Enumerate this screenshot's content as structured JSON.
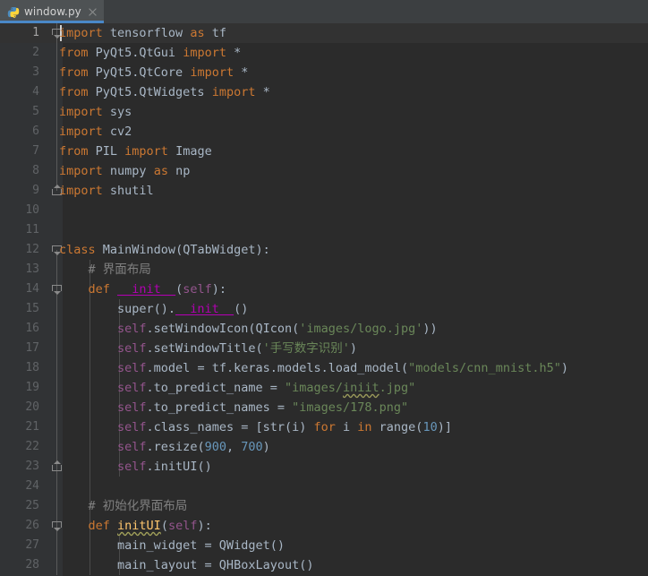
{
  "window": {
    "background": "#2b2b2b",
    "gutter_background": "#313335",
    "tabbar_background": "#3c3f41",
    "accent": "#4a88c7"
  },
  "tabs": [
    {
      "label": "window.py",
      "icon": "python-file-icon",
      "active": true,
      "close_icon": "close-icon"
    }
  ],
  "editor": {
    "language": "Python",
    "current_line": 1,
    "caret_line": 1,
    "caret_column": 1,
    "first_visible_line": 1,
    "last_visible_line": 28,
    "colors": {
      "keyword": "#cc7832",
      "string": "#6a8759",
      "number": "#6897bb",
      "comment": "#808080",
      "self": "#94558d",
      "function": "#ffc66d",
      "magic_method": "#b200b2",
      "default_text": "#a9b7c6",
      "line_number": "#606366"
    },
    "lines": [
      {
        "n": 1,
        "text": "import tensorflow as tf"
      },
      {
        "n": 2,
        "text": "from PyQt5.QtGui import *"
      },
      {
        "n": 3,
        "text": "from PyQt5.QtCore import *"
      },
      {
        "n": 4,
        "text": "from PyQt5.QtWidgets import *"
      },
      {
        "n": 5,
        "text": "import sys"
      },
      {
        "n": 6,
        "text": "import cv2"
      },
      {
        "n": 7,
        "text": "from PIL import Image"
      },
      {
        "n": 8,
        "text": "import numpy as np"
      },
      {
        "n": 9,
        "text": "import shutil"
      },
      {
        "n": 10,
        "text": ""
      },
      {
        "n": 11,
        "text": ""
      },
      {
        "n": 12,
        "text": "class MainWindow(QTabWidget):"
      },
      {
        "n": 13,
        "text": "    # 界面布局"
      },
      {
        "n": 14,
        "text": "    def __init__(self):"
      },
      {
        "n": 15,
        "text": "        super().__init__()"
      },
      {
        "n": 16,
        "text": "        self.setWindowIcon(QIcon('images/logo.jpg'))"
      },
      {
        "n": 17,
        "text": "        self.setWindowTitle('手写数字识别')"
      },
      {
        "n": 18,
        "text": "        self.model = tf.keras.models.load_model(\"models/cnn_mnist.h5\")"
      },
      {
        "n": 19,
        "text": "        self.to_predict_name = \"images/iniit.jpg\""
      },
      {
        "n": 20,
        "text": "        self.to_predict_names = \"images/178.png\""
      },
      {
        "n": 21,
        "text": "        self.class_names = [str(i) for i in range(10)]"
      },
      {
        "n": 22,
        "text": "        self.resize(900, 700)"
      },
      {
        "n": 23,
        "text": "        self.initUI()"
      },
      {
        "n": 24,
        "text": ""
      },
      {
        "n": 25,
        "text": "        # 初始化界面布局"
      },
      {
        "n": 26,
        "text": "    def initUI(self):"
      },
      {
        "n": 27,
        "text": "        main_widget = QWidget()"
      },
      {
        "n": 28,
        "text": "        main_layout = QHBoxLayout()"
      }
    ],
    "line_number_labels": [
      "1",
      "2",
      "3",
      "4",
      "5",
      "6",
      "7",
      "8",
      "9",
      "10",
      "11",
      "12",
      "13",
      "14",
      "15",
      "16",
      "17",
      "18",
      "19",
      "20",
      "21",
      "22",
      "23",
      "24",
      "25",
      "26",
      "27",
      "28"
    ],
    "fold_markers": [
      {
        "line": 1,
        "type": "open"
      },
      {
        "line": 9,
        "type": "close"
      },
      {
        "line": 12,
        "type": "open"
      },
      {
        "line": 14,
        "type": "open"
      },
      {
        "line": 23,
        "type": "close"
      },
      {
        "line": 26,
        "type": "open"
      }
    ]
  }
}
